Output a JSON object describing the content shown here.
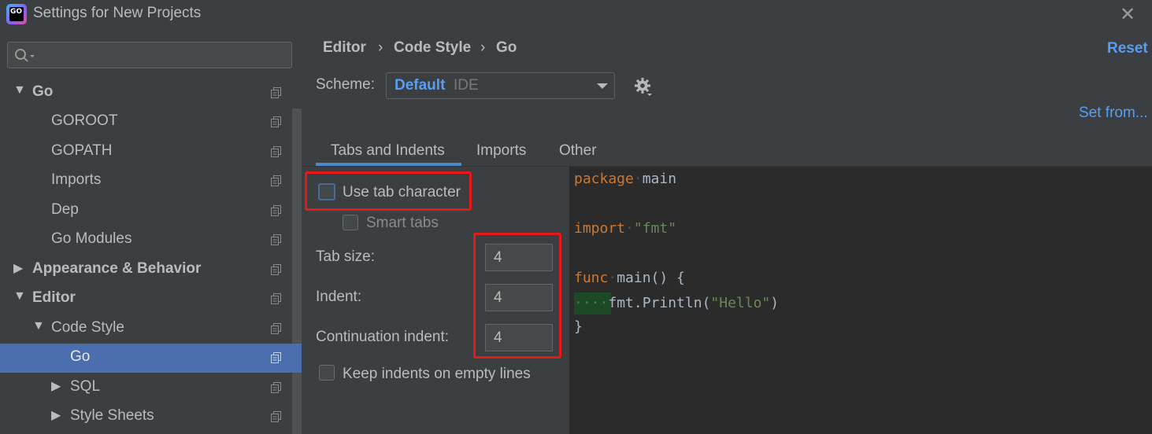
{
  "window": {
    "title": "Settings for New Projects",
    "app_icon_text": "GO",
    "close_symbol": "✕"
  },
  "sidebar": {
    "search_placeholder": "",
    "items": [
      {
        "label": "Go",
        "arrow": "▼"
      },
      {
        "label": "GOROOT"
      },
      {
        "label": "GOPATH"
      },
      {
        "label": "Imports"
      },
      {
        "label": "Dep"
      },
      {
        "label": "Go Modules"
      },
      {
        "label": "Appearance & Behavior",
        "arrow": "▶"
      },
      {
        "label": "Editor",
        "arrow": "▼"
      },
      {
        "label": "Code Style",
        "arrow": "▼"
      },
      {
        "label": "Go",
        "selected": true
      },
      {
        "label": "SQL",
        "arrow": "▶"
      },
      {
        "label": "Style Sheets",
        "arrow": "▶"
      }
    ]
  },
  "breadcrumb": {
    "items": [
      "Editor",
      "Code Style",
      "Go"
    ],
    "separator": "›"
  },
  "reset_label": "Reset",
  "scheme": {
    "label": "Scheme:",
    "name": "Default",
    "sub": "IDE"
  },
  "set_from_label": "Set from...",
  "tabs": [
    "Tabs and Indents",
    "Imports",
    "Other"
  ],
  "options": {
    "use_tab_character": {
      "label": "Use tab character",
      "checked": false
    },
    "smart_tabs": {
      "label": "Smart tabs",
      "checked": false
    },
    "tab_size": {
      "label": "Tab size:",
      "value": "4"
    },
    "indent": {
      "label": "Indent:",
      "value": "4"
    },
    "continuation_indent": {
      "label": "Continuation indent:",
      "value": "4"
    },
    "keep_indents": {
      "label": "Keep indents on empty lines",
      "checked": false
    }
  },
  "code_preview": {
    "l1_kw": "package",
    "l1_rest": "main",
    "l2_kw": "import",
    "l2_str": "\"fmt\"",
    "l3_kw": "func",
    "l3_rest": "main() {",
    "l4_ws": "····",
    "l4_a": "fmt.Println(",
    "l4_str": "\"Hello\"",
    "l4_b": ")",
    "l5": "}"
  },
  "colors": {
    "accent": "#589df6",
    "selection": "#4b6eaf",
    "highlight": "#e81818"
  }
}
